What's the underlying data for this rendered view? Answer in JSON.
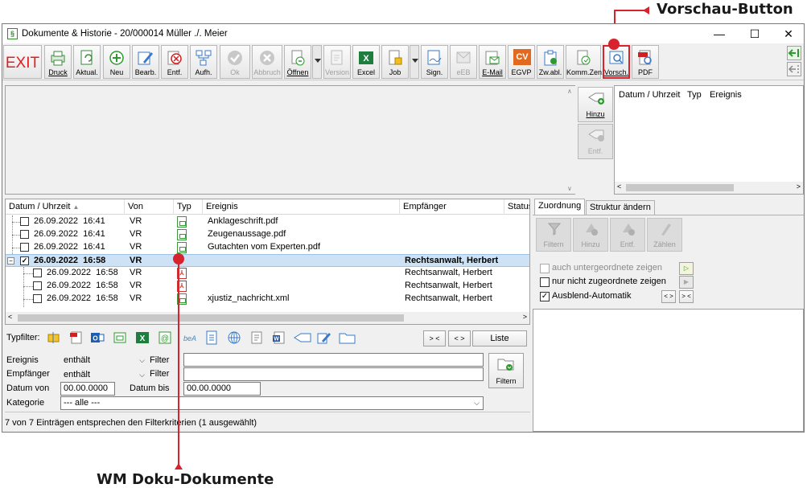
{
  "window": {
    "title": "Dokumente & Historie - 20/000014 Müller ./. Meier",
    "app_icon_glyph": "§",
    "minimize": "—",
    "maximize": "☐",
    "close": "✕"
  },
  "toolbar": {
    "exit": "EXIT",
    "buttons": [
      {
        "label": "Druck",
        "icon": "printer-icon",
        "enabled": true
      },
      {
        "label": "Aktual.",
        "icon": "refresh-icon",
        "enabled": true
      },
      {
        "label": "Neu",
        "icon": "plus-icon",
        "enabled": true
      },
      {
        "label": "Bearb.",
        "icon": "pencil-icon",
        "enabled": true
      },
      {
        "label": "Entf.",
        "icon": "delete-icon",
        "enabled": true
      },
      {
        "label": "Aufh.",
        "icon": "structure-icon",
        "enabled": true
      },
      {
        "label": "Ok",
        "icon": "checkmark-icon",
        "enabled": false
      },
      {
        "label": "Abbruch",
        "icon": "cancel-icon",
        "enabled": false
      },
      {
        "label": "Öffnen",
        "icon": "open-document-icon",
        "enabled": true
      },
      {
        "label": "Version",
        "icon": "version-icon",
        "enabled": false
      },
      {
        "label": "Excel",
        "icon": "excel-icon",
        "enabled": true
      },
      {
        "label": "Job",
        "icon": "job-icon",
        "enabled": true
      },
      {
        "label": "Sign.",
        "icon": "sign-icon",
        "enabled": true
      },
      {
        "label": "eEB",
        "icon": "eeb-icon",
        "enabled": false
      },
      {
        "label": "E-Mail",
        "icon": "email-icon",
        "enabled": true
      },
      {
        "label": "EGVP",
        "icon": "egvp-icon",
        "enabled": true
      },
      {
        "label": "Zw.abl.",
        "icon": "clipboard-icon",
        "enabled": true
      },
      {
        "label": "Komm.Zen.",
        "icon": "communication-icon",
        "enabled": true
      },
      {
        "label": "Vorsch.",
        "icon": "preview-icon",
        "enabled": true
      },
      {
        "label": "PDF",
        "icon": "pdf-icon",
        "enabled": true
      }
    ],
    "cv_text": "CV"
  },
  "side_buttons": {
    "hinzu": "Hinzu",
    "entf": "Entf."
  },
  "history_panel": {
    "columns": [
      "Datum / Uhrzeit",
      "Typ",
      "Ereignis"
    ]
  },
  "doc_list": {
    "columns": [
      "Datum / Uhrzeit",
      "Von",
      "Typ",
      "Ereignis",
      "Empfänger",
      "Status"
    ],
    "sort_indicator": "▲",
    "rows": [
      {
        "datetime": "26.09.2022  16:41",
        "von": "VR",
        "typ": "doc",
        "ereignis": "Anklageschrift.pdf",
        "empfaenger": "",
        "checked": false,
        "level": 0,
        "selected": false
      },
      {
        "datetime": "26.09.2022  16:41",
        "von": "VR",
        "typ": "doc",
        "ereignis": "Zeugenaussage.pdf",
        "empfaenger": "",
        "checked": false,
        "level": 0,
        "selected": false
      },
      {
        "datetime": "26.09.2022  16:41",
        "von": "VR",
        "typ": "doc",
        "ereignis": "Gutachten vom Experten.pdf",
        "empfaenger": "",
        "checked": false,
        "level": 0,
        "selected": false
      },
      {
        "datetime": "26.09.2022  16:58",
        "von": "VR",
        "typ": "doc",
        "ereignis": "",
        "empfaenger": "Rechtsanwalt, Herbert",
        "checked": true,
        "level": 0,
        "selected": true
      },
      {
        "datetime": "26.09.2022  16:58",
        "von": "VR",
        "typ": "pdf",
        "ereignis": "",
        "empfaenger": "Rechtsanwalt, Herbert",
        "checked": false,
        "level": 1,
        "selected": false
      },
      {
        "datetime": "26.09.2022  16:58",
        "von": "VR",
        "typ": "pdf",
        "ereignis": "",
        "empfaenger": "Rechtsanwalt, Herbert",
        "checked": false,
        "level": 1,
        "selected": false
      },
      {
        "datetime": "26.09.2022  16:58",
        "von": "VR",
        "typ": "doc",
        "ereignis": "xjustiz_nachricht.xml",
        "empfaenger": "Rechtsanwalt, Herbert",
        "checked": false,
        "level": 1,
        "selected": false
      }
    ],
    "collapse_glyph": "−"
  },
  "typfilter": {
    "label": "Typfilter:",
    "icons": [
      "label-icon",
      "pdf-icon",
      "outlook-icon",
      "document-icon",
      "excel-icon",
      "at-icon",
      "beA-icon",
      "page-icon",
      "web-icon",
      "notes-icon",
      "word-icon",
      "send-icon",
      "edit-icon",
      "folder-icon"
    ],
    "btn_collapse": "> <",
    "btn_expand": "< >",
    "btn_liste": "Liste"
  },
  "filter": {
    "ereignis_label": "Ereignis",
    "ereignis_op": "enthält",
    "ereignis_filter_label": "Filter",
    "ereignis_value": "",
    "empfaenger_label": "Empfänger",
    "empfaenger_op": "enthält",
    "empfaenger_filter_label": "Filter",
    "empfaenger_value": "",
    "datum_von_label": "Datum von",
    "datum_von": "00.00.0000",
    "datum_bis_label": "Datum bis",
    "datum_bis": "00.00.0000",
    "kategorie_label": "Kategorie",
    "kategorie_value": "--- alle ---",
    "filtern_button": "Filtern"
  },
  "status": "7 von 7 Einträgen entsprechen den Filterkriterien (1 ausgewählt)",
  "right_panel": {
    "tabs": [
      "Zuordnung",
      "Struktur ändern"
    ],
    "buttons": [
      "Filtern",
      "Hinzu",
      "Entf.",
      "Zählen"
    ],
    "checkbox_untergeordnete": "auch untergeordnete zeigen",
    "checkbox_nicht_zugeordnete": "nur nicht zugeordnete zeigen",
    "checkbox_ausblend": "Ausblend-Automatik",
    "btn_expand": "< >",
    "btn_collapse": "> <"
  },
  "annotations": {
    "vorschau": "Vorschau-Button",
    "wm_doku": "WM Doku-Dokumente",
    "color": "#d7232d"
  }
}
